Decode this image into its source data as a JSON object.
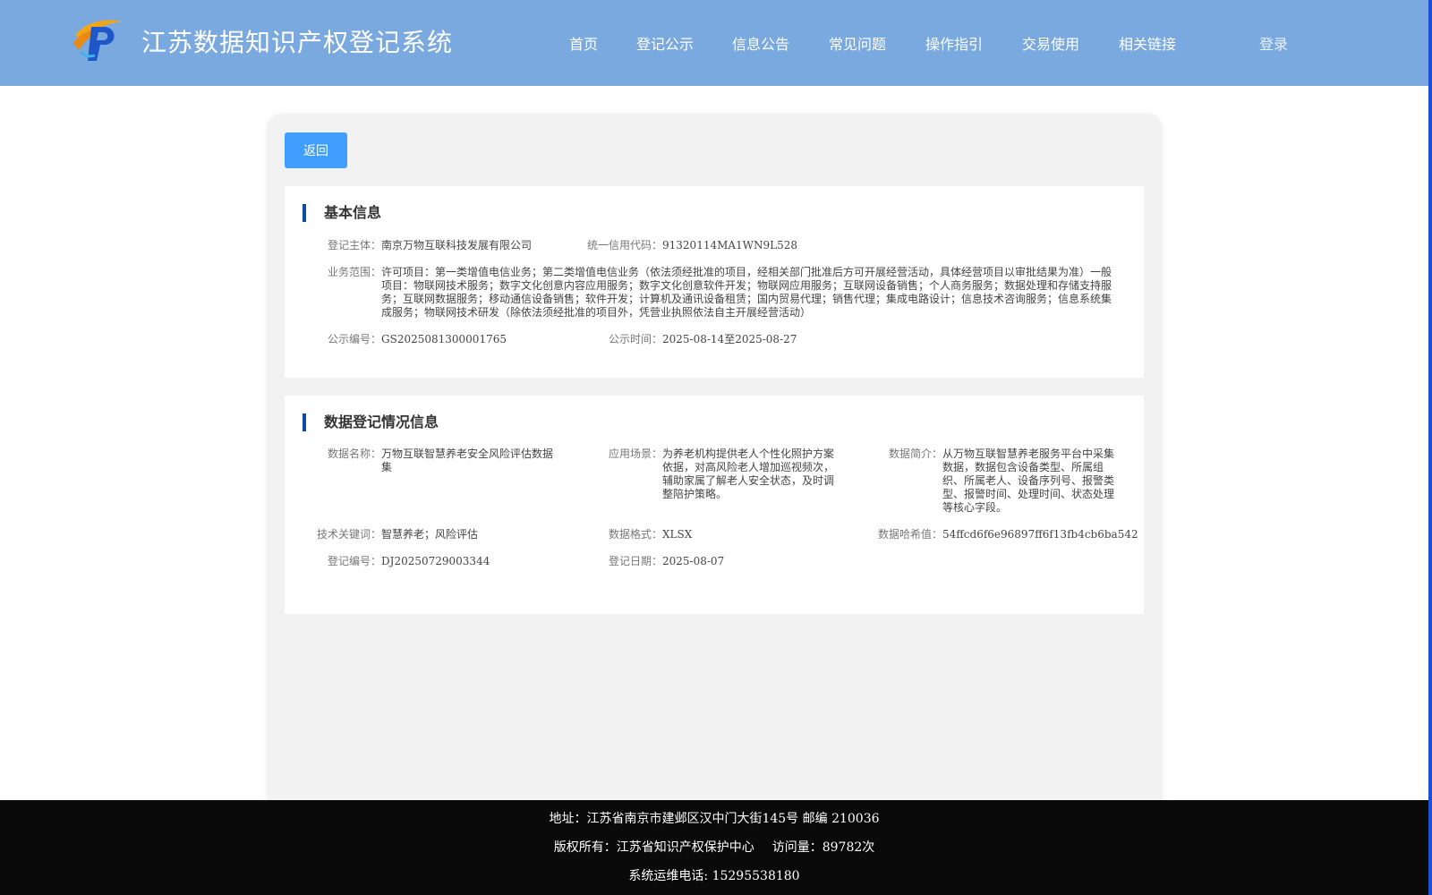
{
  "header": {
    "title": "江苏数据知识产权登记系统",
    "nav": [
      "首页",
      "登记公示",
      "信息公告",
      "常见问题",
      "操作指引",
      "交易使用",
      "相关链接"
    ],
    "login_label": "登录"
  },
  "back_label": "返回",
  "basic_info": {
    "section_title": "基本信息",
    "registrant_label": "登记主体：",
    "registrant": "南京万物互联科技发展有限公司",
    "credit_code_label": "统一信用代码：",
    "credit_code": "91320114MA1WN9L528",
    "business_scope_label": "业务范围：",
    "business_scope": "许可项目：第一类增值电信业务；第二类增值电信业务（依法须经批准的项目，经相关部门批准后方可开展经营活动，具体经营项目以审批结果为准）一般项目：物联网技术服务；数字文化创意内容应用服务；数字文化创意软件开发；物联网应用服务；互联网设备销售；个人商务服务；数据处理和存储支持服务；互联网数据服务；移动通信设备销售；软件开发；计算机及通讯设备租赁；国内贸易代理；销售代理；集成电路设计；信息技术咨询服务；信息系统集成服务；物联网技术研发（除依法须经批准的项目外，凭营业执照依法自主开展经营活动）",
    "notice_no_label": "公示编号：",
    "notice_no": "GS2025081300001765",
    "notice_time_label": "公示时间：",
    "notice_time": "2025-08-14至2025-08-27"
  },
  "data_info": {
    "section_title": "数据登记情况信息",
    "data_name_label": "数据名称：",
    "data_name": "万物互联智慧养老安全风险评估数据集",
    "scenario_label": "应用场景：",
    "scenario": "为养老机构提供老人个性化照护方案依据，对高风险老人增加巡视频次，辅助家属了解老人安全状态，及时调整陪护策略。",
    "summary_label": "数据简介：",
    "summary": "从万物互联智慧养老服务平台中采集数据，数据包含设备类型、所属组织、所属老人、设备序列号、报警类型、报警时间、处理时间、状态处理等核心字段。",
    "keywords_label": "技术关键词：",
    "keywords": "智慧养老；风险评估",
    "format_label": "数据格式：",
    "format": "XLSX",
    "hash_label": "数据哈希值：",
    "hash": "54ffcd6f6e96897ff6f13fb4cb6ba542",
    "reg_no_label": "登记编号：",
    "reg_no": "DJ20250729003344",
    "reg_date_label": "登记日期：",
    "reg_date": "2025-08-07"
  },
  "footer": {
    "address": "地址：江苏省南京市建邺区汉中门大街145号 邮编 210036",
    "copyright": "版权所有：江苏省知识产权保护中心",
    "visits_label": "访问量：",
    "visits": "89782次",
    "phone": "系统运维电话: 15295538180"
  },
  "colors": {
    "header_bg": "#7aa9df",
    "primary_button": "#409eff",
    "section_accent": "#0b4da2",
    "footer_bg": "#0a0a0a"
  }
}
